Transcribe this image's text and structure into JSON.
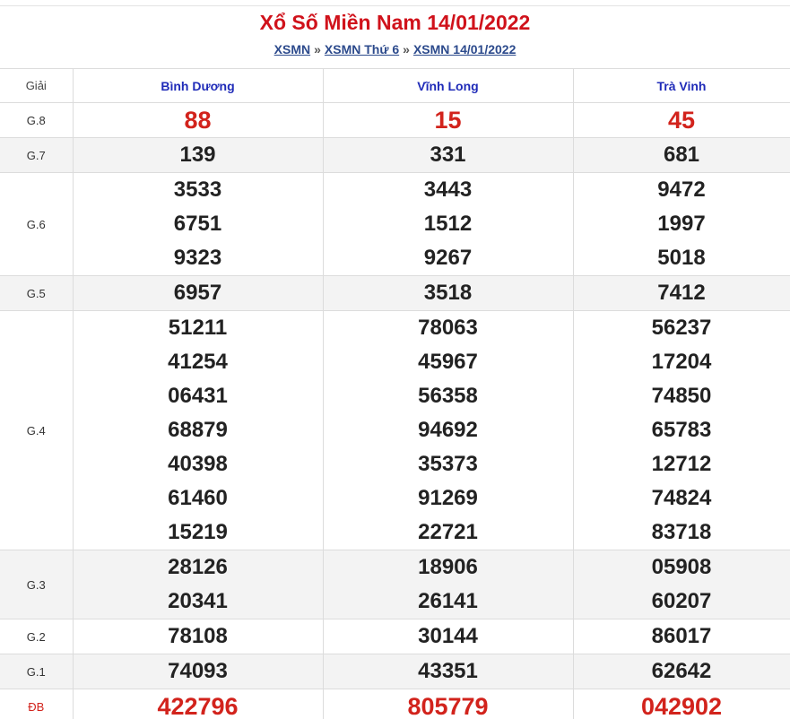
{
  "header": {
    "title": "Xổ Số Miền Nam 14/01/2022",
    "breadcrumb": [
      {
        "label": "XSMN"
      },
      {
        "label": "XSMN Thứ 6"
      },
      {
        "label": "XSMN 14/01/2022"
      }
    ],
    "separator": "»"
  },
  "table": {
    "prize_column_label": "Giải",
    "provinces": [
      "Bình Dương",
      "Vĩnh Long",
      "Trà Vinh"
    ],
    "rows": [
      {
        "prize": "G.8",
        "values": [
          [
            "88"
          ],
          [
            "15"
          ],
          [
            "45"
          ]
        ]
      },
      {
        "prize": "G.7",
        "values": [
          [
            "139"
          ],
          [
            "331"
          ],
          [
            "681"
          ]
        ]
      },
      {
        "prize": "G.6",
        "values": [
          [
            "3533",
            "6751",
            "9323"
          ],
          [
            "3443",
            "1512",
            "9267"
          ],
          [
            "9472",
            "1997",
            "5018"
          ]
        ]
      },
      {
        "prize": "G.5",
        "values": [
          [
            "6957"
          ],
          [
            "3518"
          ],
          [
            "7412"
          ]
        ]
      },
      {
        "prize": "G.4",
        "values": [
          [
            "51211",
            "41254",
            "06431",
            "68879",
            "40398",
            "61460",
            "15219"
          ],
          [
            "78063",
            "45967",
            "56358",
            "94692",
            "35373",
            "91269",
            "22721"
          ],
          [
            "56237",
            "17204",
            "74850",
            "65783",
            "12712",
            "74824",
            "83718"
          ]
        ]
      },
      {
        "prize": "G.3",
        "values": [
          [
            "28126",
            "20341"
          ],
          [
            "18906",
            "26141"
          ],
          [
            "05908",
            "60207"
          ]
        ]
      },
      {
        "prize": "G.2",
        "values": [
          [
            "78108"
          ],
          [
            "30144"
          ],
          [
            "86017"
          ]
        ]
      },
      {
        "prize": "G.1",
        "values": [
          [
            "74093"
          ],
          [
            "43351"
          ],
          [
            "62642"
          ]
        ]
      },
      {
        "prize": "ĐB",
        "values": [
          [
            "422796"
          ],
          [
            "805779"
          ],
          [
            "042902"
          ]
        ]
      }
    ]
  },
  "colors": {
    "title": "#d0121b",
    "highlight_number": "#d2231c",
    "province_header": "#1f2bb8",
    "link": "#2c4a8c",
    "alt_row": "#f3f3f3"
  }
}
